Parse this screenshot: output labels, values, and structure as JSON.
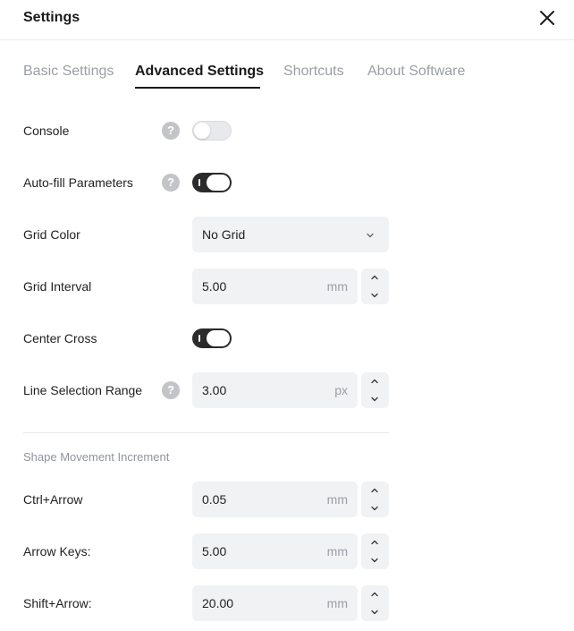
{
  "header": {
    "title": "Settings",
    "close_icon": "close-icon"
  },
  "tabs": [
    {
      "label": "Basic Settings",
      "active": false
    },
    {
      "label": "Advanced Settings",
      "active": true
    },
    {
      "label": "Shortcuts",
      "active": false
    },
    {
      "label": "About Software",
      "active": false
    }
  ],
  "settings": {
    "console": {
      "label": "Console",
      "help": "?",
      "enabled": false
    },
    "autofill": {
      "label": "Auto-fill Parameters",
      "help": "?",
      "enabled": true
    },
    "grid_color": {
      "label": "Grid Color",
      "value": "No Grid"
    },
    "grid_interval": {
      "label": "Grid Interval",
      "value": "5.00",
      "unit": "mm"
    },
    "center_cross": {
      "label": "Center Cross",
      "enabled": true
    },
    "line_selection": {
      "label": "Line Selection Range",
      "help": "?",
      "value": "3.00",
      "unit": "px"
    }
  },
  "shape_movement": {
    "title": "Shape Movement Increment",
    "ctrl_arrow": {
      "label": "Ctrl+Arrow",
      "value": "0.05",
      "unit": "mm"
    },
    "arrow_keys": {
      "label": "Arrow Keys:",
      "value": "5.00",
      "unit": "mm"
    },
    "shift_arrow": {
      "label": "Shift+Arrow:",
      "value": "20.00",
      "unit": "mm"
    }
  },
  "colors": {
    "accent": "#2b2b2b",
    "muted_text": "#9a9ea5",
    "field_bg": "#f1f2f4",
    "help_icon": "#c2c4c8"
  }
}
